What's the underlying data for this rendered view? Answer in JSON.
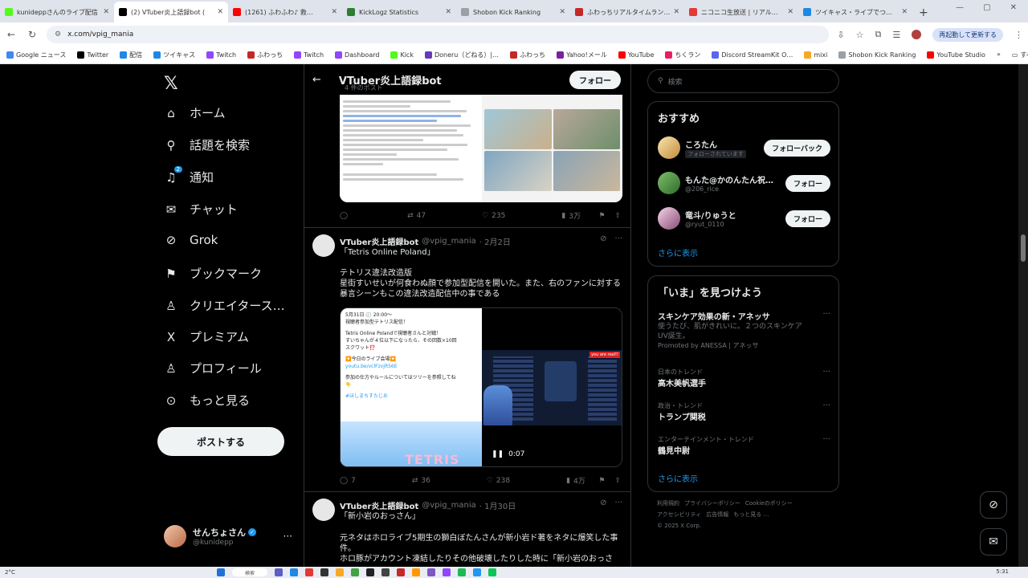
{
  "browser": {
    "tabs": [
      {
        "label": "kunideppさんのライブ配信",
        "color": "#53fc18",
        "active": false
      },
      {
        "label": "(2) VTuber炎上語録bot (",
        "color": "#000000",
        "active": true
      },
      {
        "label": "(1261) ふわふわ♪ 救…",
        "color": "#ff0000",
        "active": false
      },
      {
        "label": "KickLogz Statistics",
        "color": "#2e7d32",
        "active": false
      },
      {
        "label": "Shobon Kick Ranking",
        "color": "#9aa0a6",
        "active": false
      },
      {
        "label": "ふわっちリアルタイムランキング",
        "color": "#c62828",
        "active": false
      },
      {
        "label": "ニコニコ生放送 | リアルタイム…",
        "color": "#e53935",
        "active": false
      },
      {
        "label": "ツイキャス・ライブでつながる",
        "color": "#1e88e5",
        "active": false
      }
    ],
    "new_tab": "+",
    "url": "x.com/vpig_mania",
    "restart_label": "再起動して更新する",
    "bookmarks": [
      {
        "label": "Google ニュース",
        "color": "#4285f4"
      },
      {
        "label": "Twitter",
        "color": "#000000"
      },
      {
        "label": "配信",
        "color": "#1e88e5"
      },
      {
        "label": "ツイキャス",
        "color": "#1e88e5"
      },
      {
        "label": "Twitch",
        "color": "#9146ff"
      },
      {
        "label": "ふわっち",
        "color": "#c62828"
      },
      {
        "label": "Twitch",
        "color": "#9146ff"
      },
      {
        "label": "Dashboard",
        "color": "#9146ff"
      },
      {
        "label": "Kick",
        "color": "#53fc18"
      },
      {
        "label": "Doneru（どねる）|…",
        "color": "#673ab7"
      },
      {
        "label": "ふわっち",
        "color": "#c62828"
      },
      {
        "label": "Yahoo!メール",
        "color": "#7b1fa2"
      },
      {
        "label": "YouTube",
        "color": "#ff0000"
      },
      {
        "label": "ちくラン",
        "color": "#e91e63"
      },
      {
        "label": "Discord StreamKit O…",
        "color": "#5865f2"
      },
      {
        "label": "mixi",
        "color": "#f9a825"
      },
      {
        "label": "Shobon Kick Ranking",
        "color": "#9aa0a6"
      },
      {
        "label": "YouTube Studio",
        "color": "#ff0000"
      }
    ],
    "bookmarks_more": "»",
    "all_bookmarks": "すべてのブックマーク"
  },
  "nav": {
    "items": [
      {
        "label": "ホーム",
        "icon": "home-icon",
        "glyph": "⌂"
      },
      {
        "label": "話題を検索",
        "icon": "search-icon",
        "glyph": "⚲"
      },
      {
        "label": "通知",
        "icon": "bell-icon",
        "glyph": "♫",
        "badge": "2"
      },
      {
        "label": "チャット",
        "icon": "mail-icon",
        "glyph": "✉"
      },
      {
        "label": "Grok",
        "icon": "grok-icon",
        "glyph": "⊘"
      },
      {
        "label": "ブックマーク",
        "icon": "bookmark-icon",
        "glyph": "⚑"
      },
      {
        "label": "クリエイタース…",
        "icon": "creator-icon",
        "glyph": "♙"
      },
      {
        "label": "プレミアム",
        "icon": "x-premium-icon",
        "glyph": "X"
      },
      {
        "label": "プロフィール",
        "icon": "profile-icon",
        "glyph": "♙"
      },
      {
        "label": "もっと見る",
        "icon": "more-icon",
        "glyph": "⊙"
      }
    ],
    "post_button": "ポストする",
    "account": {
      "name": "せんちょさん",
      "handle": "@kunidepp"
    }
  },
  "header": {
    "title": "VTuber炎上語録bot",
    "subtitle": "4 件のポスト",
    "follow": "フォロー"
  },
  "tweets": [
    {
      "actions": {
        "reply": "",
        "retweet": "47",
        "like": "235",
        "views": "3万"
      }
    },
    {
      "name": "VTuber炎上語録bot",
      "handle": "@vpig_mania",
      "date": "· 2月2日",
      "title": "「Tetris Online Poland」",
      "body": "テトリス違法改造版\n星街すいせいが何食わぬ顔で参加型配信を開いた。また、右のファンに対する暴言シーンもこの違法改造配信中の事である",
      "video_text": [
        "5月31日 🕗 20:00〜",
        "視聴者参加型テトリス配信！",
        "",
        "Tetris Online Polandで視聴者さんと対戦！",
        "すいちゃんが４位以下になったら、その回数×10回",
        "スクワット⁉️",
        "",
        "🔽今日のライブ会場🔽",
        "youtu.be/vclFzvjR56E",
        "",
        "参加の仕方やルールについてはツリーを参照してね",
        "👇",
        "",
        "#ほしまちすたじお"
      ],
      "video_time": "0:07",
      "actions": {
        "reply": "7",
        "retweet": "36",
        "like": "238",
        "views": "4万"
      }
    },
    {
      "name": "VTuber炎上語録bot",
      "handle": "@vpig_mania",
      "date": "· 1月30日",
      "title": "「新小岩のおっさん」",
      "body": "元ネタはホロライブ5期生の獅白ぼたんさんが新小岩ド著をネタに爆笑した事件。\nホロ豚がアカウント凍結したりその他破壊したりした時に「新小岩のおっさ"
    }
  ],
  "sidebar": {
    "search_placeholder": "検索",
    "who_to_follow": {
      "title": "おすすめ",
      "users": [
        {
          "name": "ころたん",
          "handle": "フォローされています",
          "button": "フォローバック",
          "pill": true
        },
        {
          "name": "もんた@かのんたん祝…",
          "handle": "@206_rice",
          "button": "フォロー"
        },
        {
          "name": "竜斗/りゅうと",
          "handle": "@ryut_0110",
          "button": "フォロー"
        }
      ],
      "show_more": "さらに表示"
    },
    "trends": {
      "title": "「いま」を見つけよう",
      "items": [
        {
          "title": "スキンケア効果の新・アネッサ",
          "desc": "使うたび、肌がきれいに。２つのスキンケアUV誕生。",
          "promo": "Promoted by ANESSA | アネッサ"
        },
        {
          "sub": "日本のトレンド",
          "title": "高木美帆選手"
        },
        {
          "sub": "政治・トレンド",
          "title": "トランプ関税"
        },
        {
          "sub": "エンターテインメント・トレンド",
          "title": "鶴見中尉"
        }
      ],
      "show_more": "さらに表示"
    },
    "footer": [
      "利用規約",
      "プライバシーポリシー",
      "Cookieのポリシー",
      "アクセシビリティ",
      "広告情報",
      "もっと見る …",
      "© 2025 X Corp."
    ]
  },
  "taskbar": {
    "weather": "2°C",
    "search": "検索",
    "time": "5:31"
  }
}
